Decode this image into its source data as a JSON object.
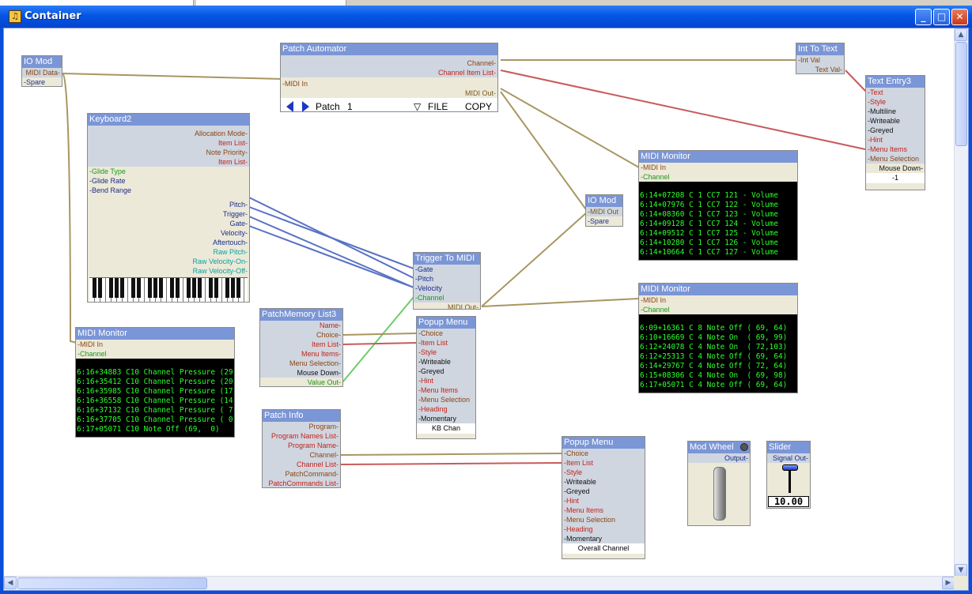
{
  "window": {
    "title": "Container",
    "min": "_",
    "max": "□",
    "close": "✕"
  },
  "io_mod1": {
    "title": "IO Mod",
    "midi_data": "MIDI Data-",
    "spare": "-Spare"
  },
  "patch_automator": {
    "title": "Patch Automator",
    "channel": "Channel-",
    "channel_item_list": "Channel Item List-",
    "midi_in": "-MIDI In",
    "midi_out": "MIDI Out-",
    "patch_label": "Patch",
    "patch_value": "1",
    "file": "FILE",
    "copy": "COPY"
  },
  "int_to_text": {
    "title": "Int To Text",
    "int_val": "-Int Val",
    "text_val": "Text Val-"
  },
  "text_entry3": {
    "title": "Text Entry3",
    "rows": [
      "-Text",
      "-Style",
      "-Multiline",
      "-Writeable",
      "-Greyed",
      "-Hint",
      "-Menu Items",
      "-Menu Selection"
    ],
    "mouse_down": "Mouse Down-",
    "value": "-1"
  },
  "keyboard2": {
    "title": "Keyboard2",
    "right_top": [
      "Allocation Mode-",
      "Item List-",
      "Note Priority-",
      "Item List-"
    ],
    "left": [
      "-Glide Type",
      "-Glide Rate",
      "-Bend Range"
    ],
    "right_bottom": [
      "Pitch-",
      "Trigger-",
      "Gate-",
      "Velocity-",
      "Aftertouch-",
      "Raw Pitch-",
      "Raw Velocity-On-",
      "Raw Velocity-Off-"
    ]
  },
  "midi_monitor1": {
    "title": "MIDI Monitor",
    "midi_in": "-MIDI In",
    "channel": "-Channel",
    "lines": [
      "6:14+07208 C 1 CC7 121 - Volume",
      "6:14+07976 C 1 CC7 122 - Volume",
      "6:14+08360 C 1 CC7 123 - Volume",
      "6:14+09128 C 1 CC7 124 - Volume",
      "6:14+09512 C 1 CC7 125 - Volume",
      "6:14+10280 C 1 CC7 126 - Volume",
      "6:14+10664 C 1 CC7 127 - Volume"
    ]
  },
  "io_mod2": {
    "title": "IO Mod",
    "midi_out": "-MIDI Out",
    "spare": "-Spare"
  },
  "trigger_to_midi": {
    "title": "Trigger To MIDI",
    "rows": [
      "-Gate",
      "-Pitch",
      "-Velocity",
      "-Channel"
    ],
    "midi_out": "MIDI Out-"
  },
  "midi_monitor2": {
    "title": "MIDI Monitor",
    "midi_in": "-MIDI In",
    "channel": "-Channel",
    "lines": [
      "6:09+16361 C 8 Note Off ( 69, 64)",
      "6:10+16669 C 4 Note On  ( 69, 99)",
      "6:12+24078 C 4 Note On  ( 72,103)",
      "6:12+25313 C 4 Note Off ( 69, 64)",
      "6:14+29767 C 4 Note Off ( 72, 64)",
      "6:15+08306 C 4 Note On  ( 69, 98)",
      "6:17+05071 C 4 Note Off ( 69, 64)"
    ]
  },
  "midi_monitor3": {
    "title": "MIDI Monitor",
    "midi_in": "-MIDI In",
    "channel": "-Channel",
    "lines": [
      "6:16+34883 C10 Channel Pressure (29)",
      "6:16+35412 C10 Channel Pressure (20)",
      "6:16+35985 C10 Channel Pressure (17)",
      "6:16+36558 C10 Channel Pressure (14)",
      "6:16+37132 C10 Channel Pressure ( 7)",
      "6:16+37705 C10 Channel Pressure ( 0)",
      "6:17+05071 C10 Note Off (69,  0)"
    ]
  },
  "patch_memory": {
    "title": "PatchMemory List3",
    "rows": [
      "Name-",
      "Choice-",
      "Item List-",
      "Menu Items-",
      "Menu Selection-",
      "Mouse Down-"
    ],
    "value_out": "Value Out-"
  },
  "popup_menu1": {
    "title": "Popup Menu",
    "rows": [
      "-Choice",
      "-Item List",
      "-Style",
      "-Writeable",
      "-Greyed",
      "-Hint",
      "-Menu Items",
      "-Menu Selection",
      "-Heading",
      "-Momentary"
    ],
    "value": "KB Chan"
  },
  "patch_info": {
    "title": "Patch Info",
    "rows": [
      "Program-",
      "Program Names List-",
      "Program Name-",
      "Channel-",
      "Channel List-",
      "PatchCommand-",
      "PatchCommands List-"
    ]
  },
  "popup_menu2": {
    "title": "Popup Menu",
    "rows": [
      "-Choice",
      "-Item List",
      "-Style",
      "-Writeable",
      "-Greyed",
      "-Hint",
      "-Menu Items",
      "-Menu Selection",
      "-Heading",
      "-Momentary"
    ],
    "value": "Overall Channel"
  },
  "mod_wheel": {
    "title": "Mod Wheel",
    "output": "Output-"
  },
  "slider": {
    "title": "Slider",
    "signal_out": "Signal Out-",
    "value": "10.00"
  },
  "scroll": {
    "up": "▲",
    "down": "▼",
    "left": "◀",
    "right": "▶"
  }
}
